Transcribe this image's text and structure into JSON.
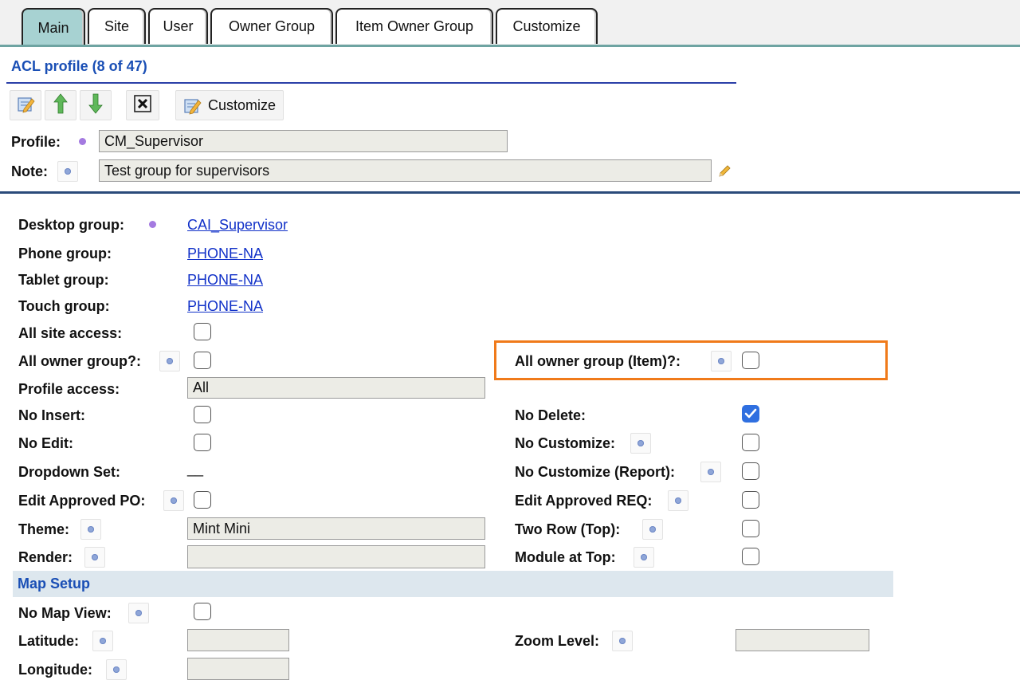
{
  "tabs": [
    {
      "label": "Main"
    },
    {
      "label": "Site"
    },
    {
      "label": "User"
    },
    {
      "label": "Owner Group"
    },
    {
      "label": "Item Owner Group"
    },
    {
      "label": "Customize"
    }
  ],
  "header": {
    "title": "ACL profile (8 of 47)"
  },
  "toolbar": {
    "customize_label": "Customize",
    "icons": [
      "edit-icon",
      "move-up-icon",
      "move-down-icon",
      "delete-icon",
      "customize-icon"
    ]
  },
  "profile": {
    "profile_label": "Profile:",
    "profile_value": "CM_Supervisor",
    "note_label": "Note:",
    "note_value": "Test group for supervisors"
  },
  "form": {
    "desktop_group_label": "Desktop group:",
    "desktop_group_value": "CAI_Supervisor",
    "phone_group_label": "Phone group:",
    "phone_group_value": "PHONE-NA",
    "tablet_group_label": "Tablet group:",
    "tablet_group_value": "PHONE-NA",
    "touch_group_label": "Touch group:",
    "touch_group_value": "PHONE-NA",
    "all_site_access_label": "All site access:",
    "all_owner_group_label": "All owner group?:",
    "all_owner_group_item_label": "All owner group (Item)?:",
    "profile_access_label": "Profile access:",
    "profile_access_value": "All",
    "no_insert_label": "No Insert:",
    "no_delete_label": "No Delete:",
    "no_edit_label": "No Edit:",
    "no_customize_label": "No Customize:",
    "dropdown_set_label": "Dropdown Set:",
    "dropdown_set_value": "__",
    "no_customize_report_label": "No Customize (Report):",
    "edit_approved_po_label": "Edit Approved PO:",
    "edit_approved_req_label": "Edit Approved REQ:",
    "theme_label": "Theme:",
    "theme_value": "Mint Mini",
    "two_row_top_label": "Two Row (Top):",
    "render_label": "Render:",
    "render_value": "",
    "module_at_top_label": "Module at Top:"
  },
  "checkboxes": {
    "all_site_access": false,
    "all_owner_group": false,
    "all_owner_group_item": false,
    "no_insert": false,
    "no_delete": true,
    "no_edit": false,
    "no_customize": false,
    "no_customize_report": false,
    "edit_approved_po": false,
    "edit_approved_req": false,
    "two_row_top": false,
    "module_at_top": false,
    "no_map_view": false
  },
  "map_setup": {
    "title": "Map Setup",
    "no_map_view_label": "No Map View:",
    "latitude_label": "Latitude:",
    "latitude_value": "",
    "longitude_label": "Longitude:",
    "longitude_value": "",
    "zoom_level_label": "Zoom Level:",
    "zoom_level_value": ""
  },
  "colors": {
    "active_tab": "#a7d2d2",
    "link": "#1030c8",
    "title": "#1a4fb5",
    "highlight": "#f07a1a",
    "checked": "#2f6fe0"
  }
}
